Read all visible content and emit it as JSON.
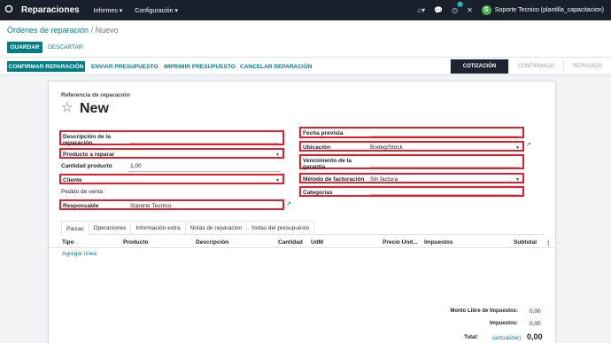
{
  "navbar": {
    "apps_icon": "grid-icon",
    "app_name": "Reparaciones",
    "menus": [
      "Informes ▾",
      "Configuración ▾"
    ],
    "chat_badge": "2",
    "user_initial": "S",
    "user_name": "Soporte Tecnico (plantilla_capacitacion)"
  },
  "breadcrumb": {
    "parent": "Órdenes de reparación",
    "separator": "/",
    "current": "Nuevo"
  },
  "buttons": {
    "save": "GUARDAR",
    "discard": "DESCARTAR"
  },
  "actions": {
    "confirm": "CONFIRMAR REPARACIÓN",
    "send_quote": "ENVIAR PRESUPUESTO",
    "print_quote": "IMPRIMIR PRESUPUESTO",
    "cancel": "CANCELAR REPARACIÓN"
  },
  "stages": [
    "COTIZACIÓN",
    "CONFIRMADO",
    "REPASADO"
  ],
  "form": {
    "ref_label": "Referencia de reparación",
    "name": "New",
    "left": {
      "description_label": "Descripción de la reparación",
      "product_label": "Producto a reparar",
      "qty_label": "Cantidad producto",
      "qty_value": "1,00",
      "customer_label": "Cliente",
      "sale_order_label": "Pedido de venta",
      "responsible_label": "Responsable",
      "responsible_value": "Soporte Tecnico"
    },
    "right": {
      "scheduled_date_label": "Fecha prevista",
      "location_label": "Ubicación",
      "location_value": "Bodeg/Stock",
      "warranty_label": "Vencimiento de la garantía",
      "invoice_method_label": "Método de facturación",
      "invoice_method_value": "Sin factura",
      "categories_label": "Categorías"
    }
  },
  "tabs": [
    "Piezas",
    "Operaciones",
    "Información extra",
    "Notas de reparación",
    "Notas del presupuesto"
  ],
  "table": {
    "columns": [
      "Tipo",
      "Producto",
      "Descripción",
      "Cantidad",
      "UdM",
      "Precio Unit...",
      "Impuestos",
      "Subtotal"
    ],
    "add_line": "Agregar línea"
  },
  "totals": {
    "untaxed_label": "Monto Libre de Impuestos:",
    "untaxed_value": "0,00",
    "taxes_label": "Impuestos:",
    "taxes_value": "0,00",
    "total_label": "Total:",
    "recalc": "(actualizar)",
    "total_value": "0,00"
  },
  "colors": {
    "accent": "#017e84",
    "navbar": "#1a1f2c",
    "highlight": "#e0202e"
  }
}
